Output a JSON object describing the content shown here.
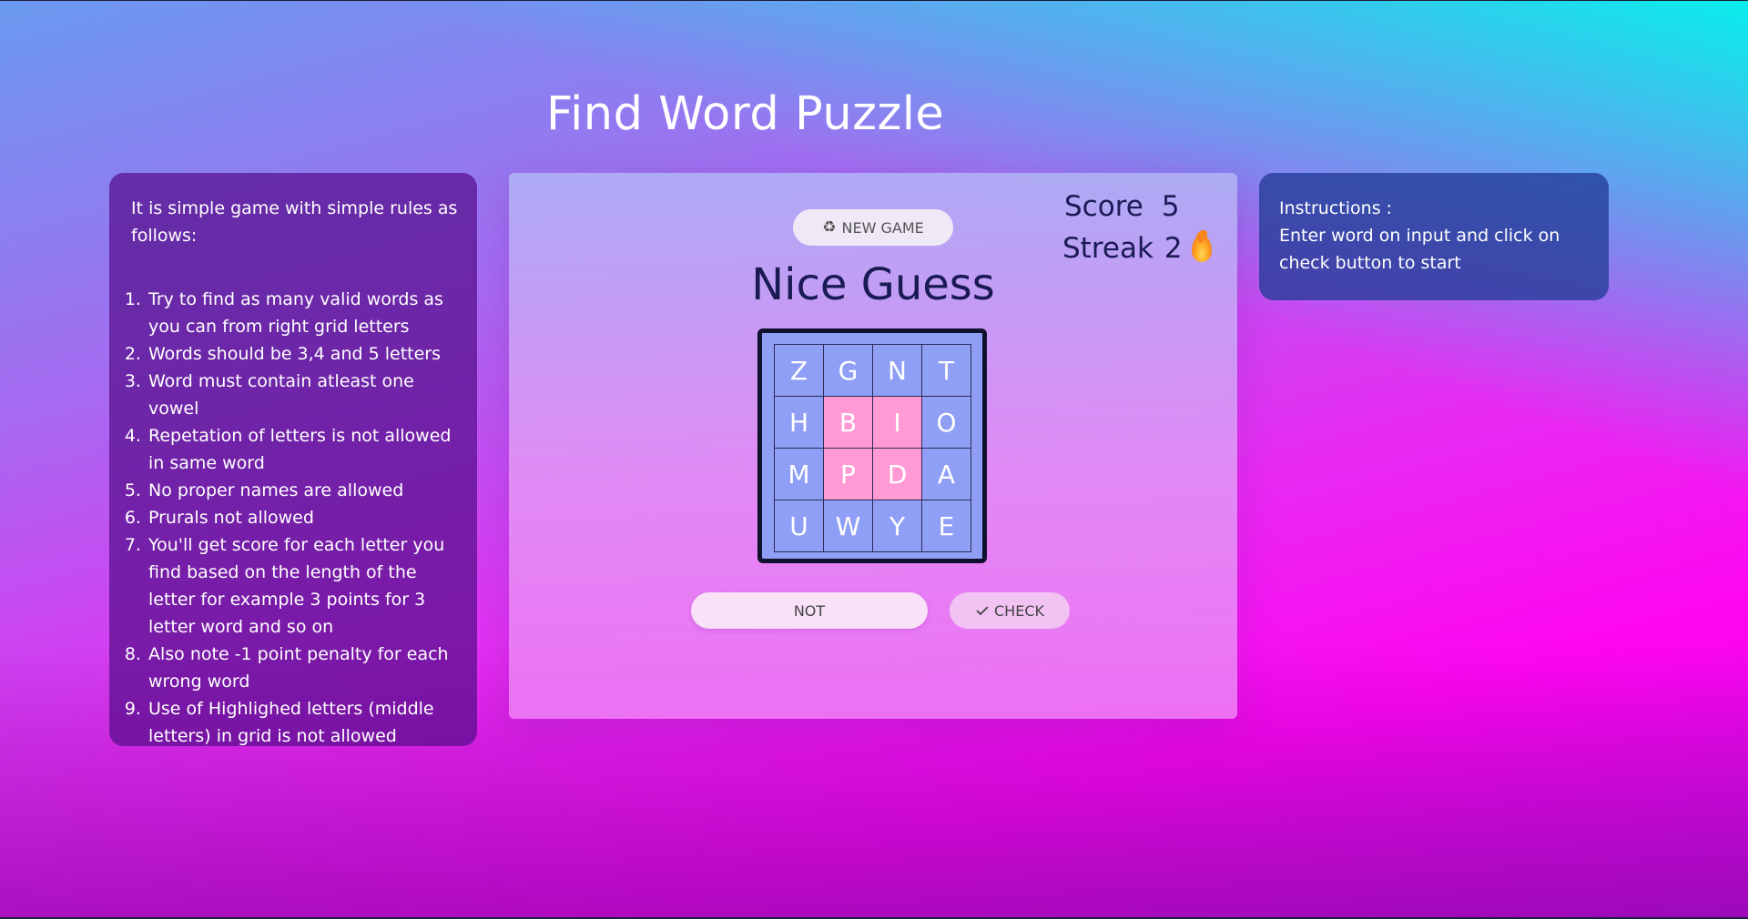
{
  "title": "Find Word Puzzle",
  "rules": {
    "intro": "It is simple game with simple rules as follows:",
    "items": [
      "Try to find as many valid words as you can from right grid letters",
      "Words should be 3,4 and 5 letters",
      "Word must contain atleast one vowel",
      "Repetation of letters is not allowed in same word",
      "No proper names are allowed",
      "Prurals not allowed",
      "You'll get score for each letter you find based on the length of the letter for example 3 points for 3 letter word and so on",
      "Also note -1 point penalty for each wrong word",
      "Use of Highlighed letters (middle letters) in grid is not allowed"
    ]
  },
  "game": {
    "new_game_label": "NEW GAME",
    "score_label": "Score",
    "score_value": "5",
    "streak_label": "Streak",
    "streak_value": "2",
    "message": "Nice Guess",
    "grid": [
      [
        {
          "letter": "Z",
          "highlighted": false
        },
        {
          "letter": "G",
          "highlighted": false
        },
        {
          "letter": "N",
          "highlighted": false
        },
        {
          "letter": "T",
          "highlighted": false
        }
      ],
      [
        {
          "letter": "H",
          "highlighted": false
        },
        {
          "letter": "B",
          "highlighted": true
        },
        {
          "letter": "I",
          "highlighted": true
        },
        {
          "letter": "O",
          "highlighted": false
        }
      ],
      [
        {
          "letter": "M",
          "highlighted": false
        },
        {
          "letter": "P",
          "highlighted": true
        },
        {
          "letter": "D",
          "highlighted": true
        },
        {
          "letter": "A",
          "highlighted": false
        }
      ],
      [
        {
          "letter": "U",
          "highlighted": false
        },
        {
          "letter": "W",
          "highlighted": false
        },
        {
          "letter": "Y",
          "highlighted": false
        },
        {
          "letter": "E",
          "highlighted": false
        }
      ]
    ],
    "input_value": "NOT",
    "check_label": "CHECK"
  },
  "instructions": {
    "heading": "Instructions :",
    "text": "Enter word on input and click on check button to start"
  },
  "colors": {
    "grid_cell": "#8f9ff6",
    "grid_highlight": "#ff9ad4",
    "text_dark": "#1a1a55",
    "streak_fire": "#f7861c"
  },
  "icons": {
    "new_game": "recycle-icon",
    "check": "checkmark-icon",
    "streak": "fire-icon"
  }
}
